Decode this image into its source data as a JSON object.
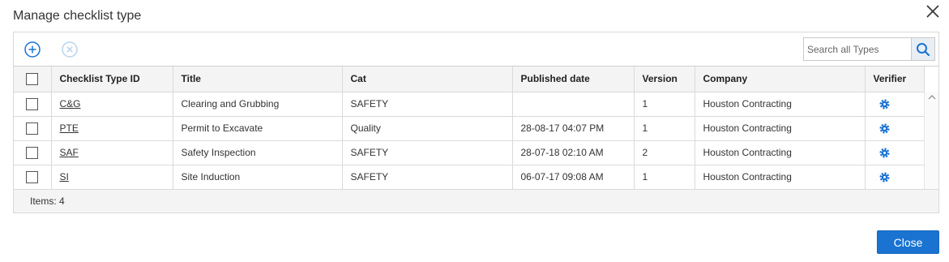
{
  "dialog": {
    "title": "Manage checklist type",
    "close_label": "Close"
  },
  "search": {
    "placeholder": "Search all Types",
    "value": ""
  },
  "table": {
    "columns": [
      "Checklist Type ID",
      "Title",
      "Cat",
      "Published date",
      "Version",
      "Company",
      "Verifier"
    ],
    "rows": [
      {
        "id": "C&G",
        "title": "Clearing and Grubbing",
        "cat": "SAFETY",
        "published": "",
        "version": "1",
        "company": "Houston Contracting"
      },
      {
        "id": "PTE",
        "title": "Permit to Excavate",
        "cat": "Quality",
        "published": "28-08-17 04:07 PM",
        "version": "1",
        "company": "Houston Contracting"
      },
      {
        "id": "SAF",
        "title": "Safety Inspection",
        "cat": "SAFETY",
        "published": "28-07-18 02:10 AM",
        "version": "2",
        "company": "Houston Contracting"
      },
      {
        "id": "SI",
        "title": "Site Induction",
        "cat": "SAFETY",
        "published": "06-07-17 09:08 AM",
        "version": "1",
        "company": "Houston Contracting"
      }
    ]
  },
  "footer": {
    "items_label": "Items: 4"
  },
  "icons": {
    "add": "plus-circle-icon",
    "remove": "x-circle-icon",
    "search": "search-icon",
    "verifier": "gear-icon",
    "close": "close-icon"
  },
  "colors": {
    "accent": "#1a73d1",
    "disabled": "#b9d3ee",
    "header_bg": "#f4f4f4"
  }
}
